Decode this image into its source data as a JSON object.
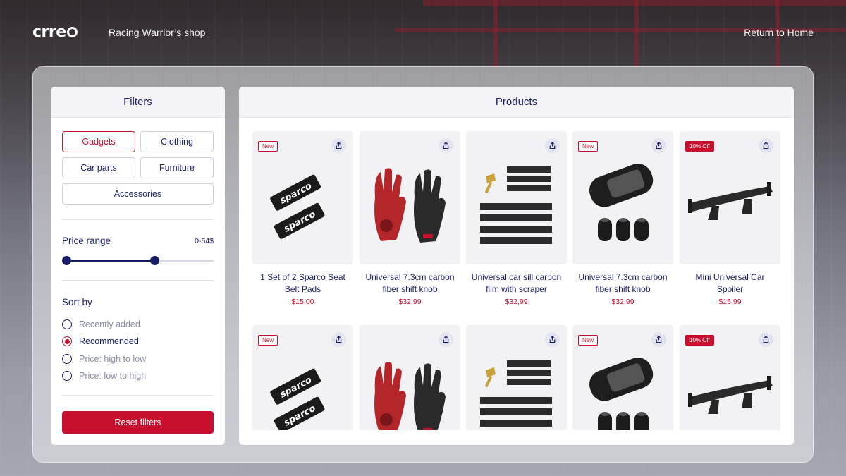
{
  "header": {
    "logo_text": "crre",
    "shop_name": "Racing Warrior’s shop",
    "return_home": "Return to Home"
  },
  "filters": {
    "title": "Filters",
    "categories": [
      {
        "label": "Gadgets",
        "active": true
      },
      {
        "label": "Clothing",
        "active": false
      },
      {
        "label": "Car parts",
        "active": false
      },
      {
        "label": "Furniture",
        "active": false
      },
      {
        "label": "Accessories",
        "active": false
      }
    ],
    "price_range": {
      "label": "Price range",
      "value": "0-54$",
      "selected_fraction": 0.6
    },
    "sort": {
      "label": "Sort by",
      "options": [
        {
          "label": "Recently added",
          "checked": false
        },
        {
          "label": "Recommended",
          "checked": true
        },
        {
          "label": "Price: high to low",
          "checked": false
        },
        {
          "label": "Price: low to high",
          "checked": false
        }
      ]
    },
    "reset_label": "Reset filters"
  },
  "products": {
    "title": "Products",
    "items": [
      {
        "name": "1 Set of 2 Sparco Seat Belt Pads",
        "price": "$15,00",
        "badge": "New",
        "image": "seat-belt-pads"
      },
      {
        "name": "Universal 7.3cm carbon fiber shift knob",
        "price": "$32.99",
        "badge": "",
        "image": "racing-gloves"
      },
      {
        "name": "Universal car sill carbon film with scraper",
        "price": "$32,99",
        "badge": "",
        "image": "carbon-film"
      },
      {
        "name": "Universal 7.3cm carbon fiber shift knob",
        "price": "$32,99",
        "badge": "New",
        "image": "shift-knob"
      },
      {
        "name": "Mini Universal Car Spoiler",
        "price": "$15,99",
        "badge": "10% Off",
        "image": "spoiler"
      },
      {
        "name": "",
        "price": "",
        "badge": "New",
        "image": "seat-belt-pads"
      },
      {
        "name": "",
        "price": "",
        "badge": "",
        "image": "racing-gloves"
      },
      {
        "name": "",
        "price": "",
        "badge": "",
        "image": "carbon-film"
      },
      {
        "name": "",
        "price": "",
        "badge": "New",
        "image": "shift-knob"
      },
      {
        "name": "",
        "price": "",
        "badge": "10% Off",
        "image": "spoiler"
      }
    ]
  },
  "colors": {
    "accent": "#c8102e",
    "navy": "#1a1f6b"
  }
}
